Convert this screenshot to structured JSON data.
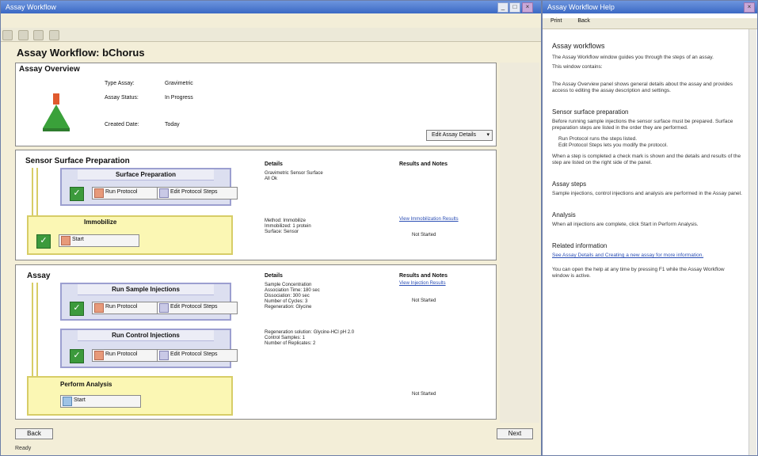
{
  "main_window": {
    "title": "Assay Workflow",
    "page_title": "Assay Workflow: bChorus"
  },
  "assay_overview": {
    "title": "Assay Overview",
    "fields": [
      {
        "label": "Type Assay:",
        "value": "Gravimetric"
      },
      {
        "label": "Assay Status:",
        "value": "In Progress"
      },
      {
        "label": "Created Date:",
        "value": "Today"
      }
    ],
    "dropdown": "Edit Assay Details"
  },
  "sensor_prep": {
    "title": "Sensor Surface Preparation",
    "details_header": "Details",
    "results_header": "Results and Notes",
    "steps": [
      {
        "title": "Surface Preparation",
        "buttons": [
          "Run Protocol",
          "Edit Protocol Steps"
        ],
        "details": [
          "Gravimetric Sensor Surface",
          "All Ok"
        ]
      },
      {
        "title": "Immobilize",
        "buttons": [
          "Start"
        ],
        "details": [
          "Method: Immobilize",
          "Immobilized: 1 protein",
          "Surface: Sensor"
        ],
        "result_link": "View Immobilization Results",
        "result_sub": "Not Started"
      }
    ]
  },
  "assay": {
    "title": "Assay",
    "details_header": "Details",
    "results_header": "Results and Notes",
    "steps": [
      {
        "title": "Run Sample Injections",
        "buttons": [
          "Run Protocol",
          "Edit Protocol Steps"
        ],
        "details": [
          "Sample Concentration",
          "Association Time: 180 sec",
          "Dissociation: 300 sec",
          "Number of Cycles: 3",
          "Regeneration: Glycine"
        ],
        "result_link": "View Injection Results",
        "result_sub": "Not Started"
      },
      {
        "title": "Run Control Injections",
        "buttons": [
          "Run Protocol",
          "Edit Protocol Steps"
        ],
        "details": [
          "Regeneration solution: Glycine-HCl pH 2.0",
          "Control Samples: 1",
          "Number of Replicates: 2"
        ]
      },
      {
        "title": "Perform Analysis",
        "buttons": [
          "Start"
        ],
        "result_sub": "Not Started"
      }
    ]
  },
  "footer": {
    "left_button": "Back",
    "right_button": "Next",
    "status": "Ready"
  },
  "help_window": {
    "title": "Assay Workflow Help",
    "tabs": [
      "Print",
      "Back"
    ],
    "heading": "Assay workflows",
    "intro": [
      "The Assay Workflow window guides you through the steps of an assay.",
      "This window contains:"
    ],
    "p1": "The Assay Overview panel shows general details about the assay and provides access to editing the assay description and settings.",
    "h2": "Sensor surface preparation",
    "p2": "Before running sample injections the sensor surface must be prepared. Surface preparation steps are listed in the order they are performed.",
    "bullets": [
      "Run Protocol runs the steps listed.",
      "Edit Protocol Steps lets you modify the protocol."
    ],
    "p3": "When a step is completed a check mark is shown and the details and results of the step are listed on the right side of the panel.",
    "h3": "Assay steps",
    "p4": "Sample injections, control injections and analysis are performed in the Assay panel.",
    "h4": "Analysis",
    "p5": "When all injections are complete, click Start in Perform Analysis.",
    "h5": "Related information",
    "p6": "See Assay Details and Creating a new assay for more information.",
    "p7": "You can open the help at any time by pressing F1 while the Assay Workflow window is active."
  }
}
